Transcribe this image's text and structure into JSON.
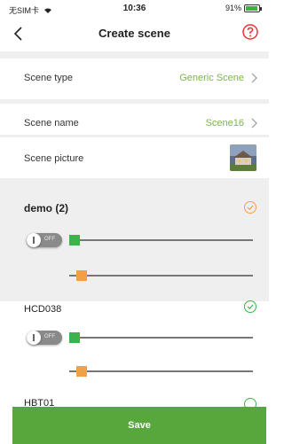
{
  "status_bar": {
    "carrier": "无SIM卡",
    "time": "10:36",
    "battery": "91%",
    "battery_level": 0.91
  },
  "nav": {
    "title": "Create scene"
  },
  "settings": {
    "scene_type_label": "Scene type",
    "scene_type_value": "Generic Scene",
    "scene_name_label": "Scene name",
    "scene_name_value": "Scene16",
    "scene_picture_label": "Scene picture"
  },
  "devices": [
    {
      "name": "demo (2)",
      "switch_state": "OFF",
      "selected": true
    },
    {
      "name": "HCD038",
      "switch_state": "OFF",
      "selected": true
    },
    {
      "name": "HBT01",
      "selected": true
    }
  ],
  "save_label": "Save",
  "colors": {
    "accent": "#57a73d",
    "green_handle": "#3cb34a",
    "orange_handle": "#f0a046",
    "check": "#f0a046"
  }
}
